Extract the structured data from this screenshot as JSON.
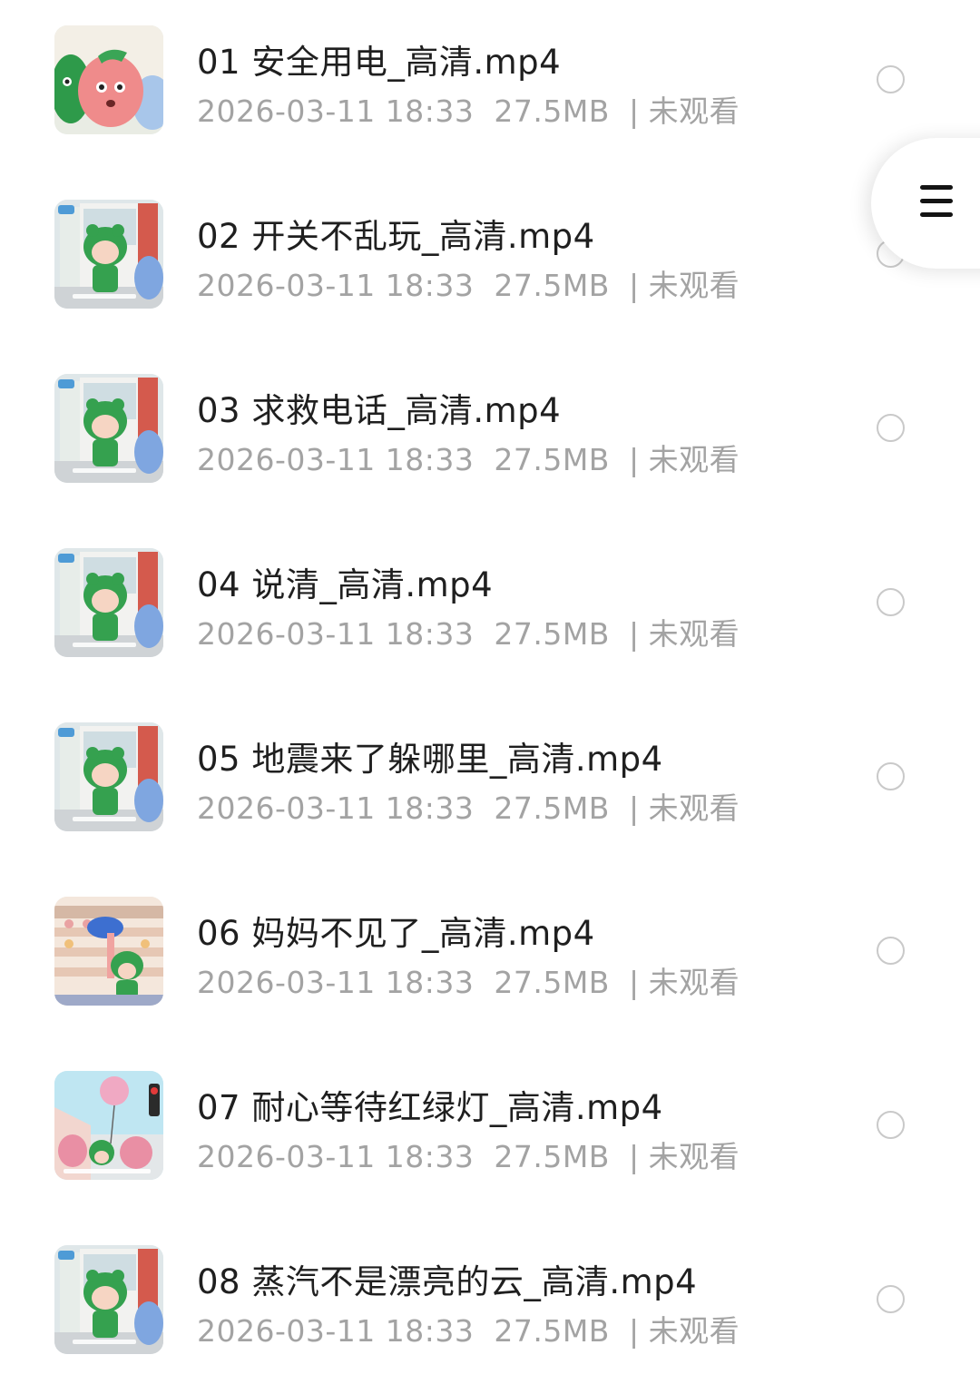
{
  "files": [
    {
      "title": "01 安全用电_高清.mp4",
      "date": "2026-03-11 18:33",
      "size": "27.5MB",
      "separator": "|",
      "status": "未观看",
      "thumb": "peach"
    },
    {
      "title": "02 开关不乱玩_高清.mp4",
      "date": "2026-03-11 18:33",
      "size": "27.5MB",
      "separator": "|",
      "status": "未观看",
      "thumb": "frog-shop"
    },
    {
      "title": "03 求救电话_高清.mp4",
      "date": "2026-03-11 18:33",
      "size": "27.5MB",
      "separator": "|",
      "status": "未观看",
      "thumb": "frog-shop"
    },
    {
      "title": "04 说清_高清.mp4",
      "date": "2026-03-11 18:33",
      "size": "27.5MB",
      "separator": "|",
      "status": "未观看",
      "thumb": "frog-shop"
    },
    {
      "title": "05 地震来了躲哪里_高清.mp4",
      "date": "2026-03-11 18:33",
      "size": "27.5MB",
      "separator": "|",
      "status": "未观看",
      "thumb": "frog-shop"
    },
    {
      "title": "06 妈妈不见了_高清.mp4",
      "date": "2026-03-11 18:33",
      "size": "27.5MB",
      "separator": "|",
      "status": "未观看",
      "thumb": "store-shelf"
    },
    {
      "title": "07 耐心等待红绿灯_高清.mp4",
      "date": "2026-03-11 18:33",
      "size": "27.5MB",
      "separator": "|",
      "status": "未观看",
      "thumb": "street"
    },
    {
      "title": "08 蒸汽不是漂亮的云_高清.mp4",
      "date": "2026-03-11 18:33",
      "size": "27.5MB",
      "separator": "|",
      "status": "未观看",
      "thumb": "frog-shop"
    }
  ],
  "floating_menu": {
    "icon": "menu-icon"
  },
  "colors": {
    "title": "#1f1f1f",
    "meta": "#a3a3a3",
    "radio_border": "#c9c9c9"
  }
}
